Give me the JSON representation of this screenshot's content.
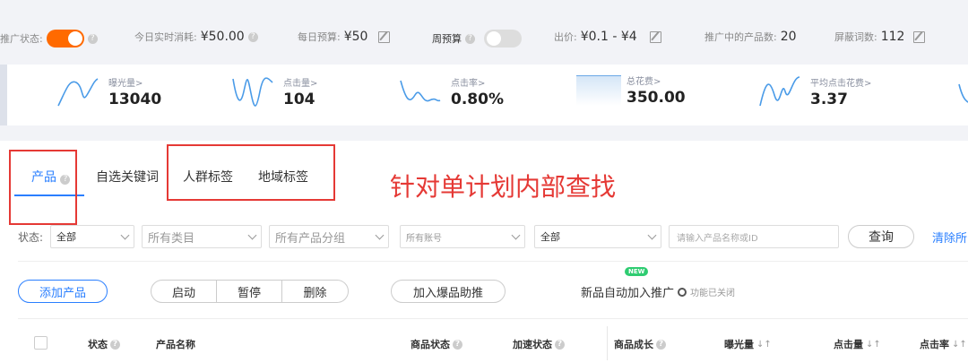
{
  "topbar": {
    "promo_status_label": "推广状态:",
    "realtime_spend_label": "今日实时消耗:",
    "realtime_spend_value": "¥50.00",
    "daily_budget_label": "每日预算:",
    "daily_budget_value": "¥50",
    "weekly_budget_label": "周预算",
    "bid_label": "出价:",
    "bid_value": "¥0.1 - ¥4",
    "products_in_promo_label": "推广中的产品数:",
    "products_in_promo_value": "20",
    "blocked_words_label": "屏蔽词数:",
    "blocked_words_value": "112",
    "promo_toggle_on": true,
    "weekly_toggle_on": false,
    "accent_color": "#ff6a00"
  },
  "metrics": [
    {
      "label": "曝光量>",
      "value": "13040"
    },
    {
      "label": "点击量>",
      "value": "104"
    },
    {
      "label": "点击率>",
      "value": "0.80%"
    },
    {
      "label": "总花费>",
      "value": "350.00"
    },
    {
      "label": "平均点击花费>",
      "value": "3.37"
    }
  ],
  "tabs": [
    {
      "label": "产品",
      "active": true
    },
    {
      "label": "自选关键词",
      "active": false
    },
    {
      "label": "人群标签",
      "active": false
    },
    {
      "label": "地域标签",
      "active": false
    }
  ],
  "annotation": "针对单计划内部查找",
  "filters": {
    "status_label": "状态:",
    "status_value": "全部",
    "category": "所有类目",
    "product_group": "所有产品分组",
    "account": "所有账号",
    "scope": "全部",
    "search_placeholder": "请输入产品名称或ID",
    "query_button": "查询",
    "clear_all": "清除所"
  },
  "actions": {
    "add_product": "添加产品",
    "start": "启动",
    "pause": "暂停",
    "delete": "删除",
    "hot_boost": "加入爆品助推",
    "new_badge": "NEW",
    "auto_add": "新品自动加入推广",
    "auto_add_status": "功能已关闭"
  },
  "table": {
    "headers": {
      "status": "状态",
      "product_name": "产品名称",
      "goods_status": "商品状态",
      "accel_status": "加速状态",
      "goods_growth": "商品成长",
      "impressions": "曝光量",
      "clicks": "点击量",
      "ctr": "点击率"
    }
  }
}
